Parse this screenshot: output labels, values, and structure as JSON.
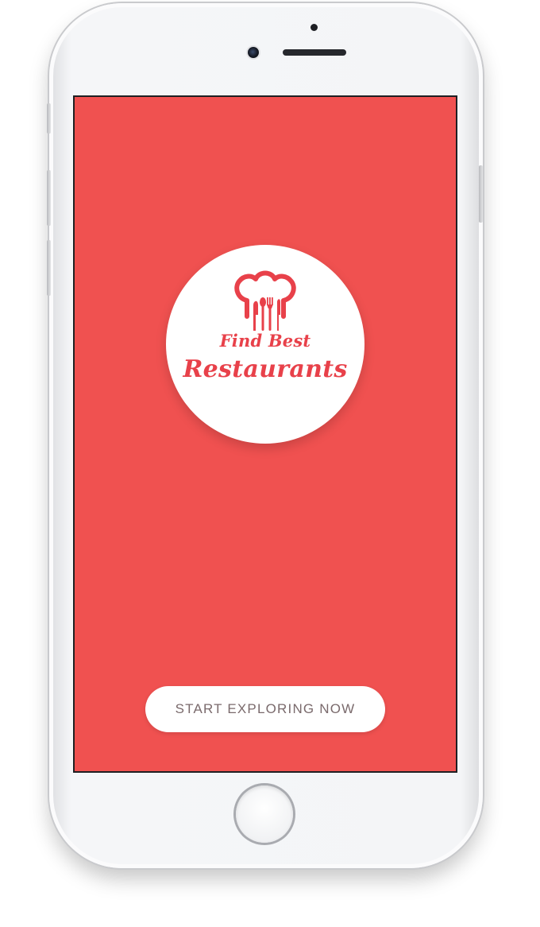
{
  "app": {
    "logo": {
      "line1": "Find Best",
      "line2": "Restaurants",
      "icon": "chef-hat-cutlery-icon"
    },
    "start_button_label": "START EXPLORING NOW"
  },
  "colors": {
    "screen_background": "#f05150",
    "brand_red": "#e8414a",
    "button_text": "#7a6a6c",
    "white": "#ffffff"
  },
  "device": {
    "icons": [
      "front-camera-icon",
      "proximity-sensor-icon",
      "earpiece-speaker-icon",
      "home-button-icon"
    ]
  }
}
